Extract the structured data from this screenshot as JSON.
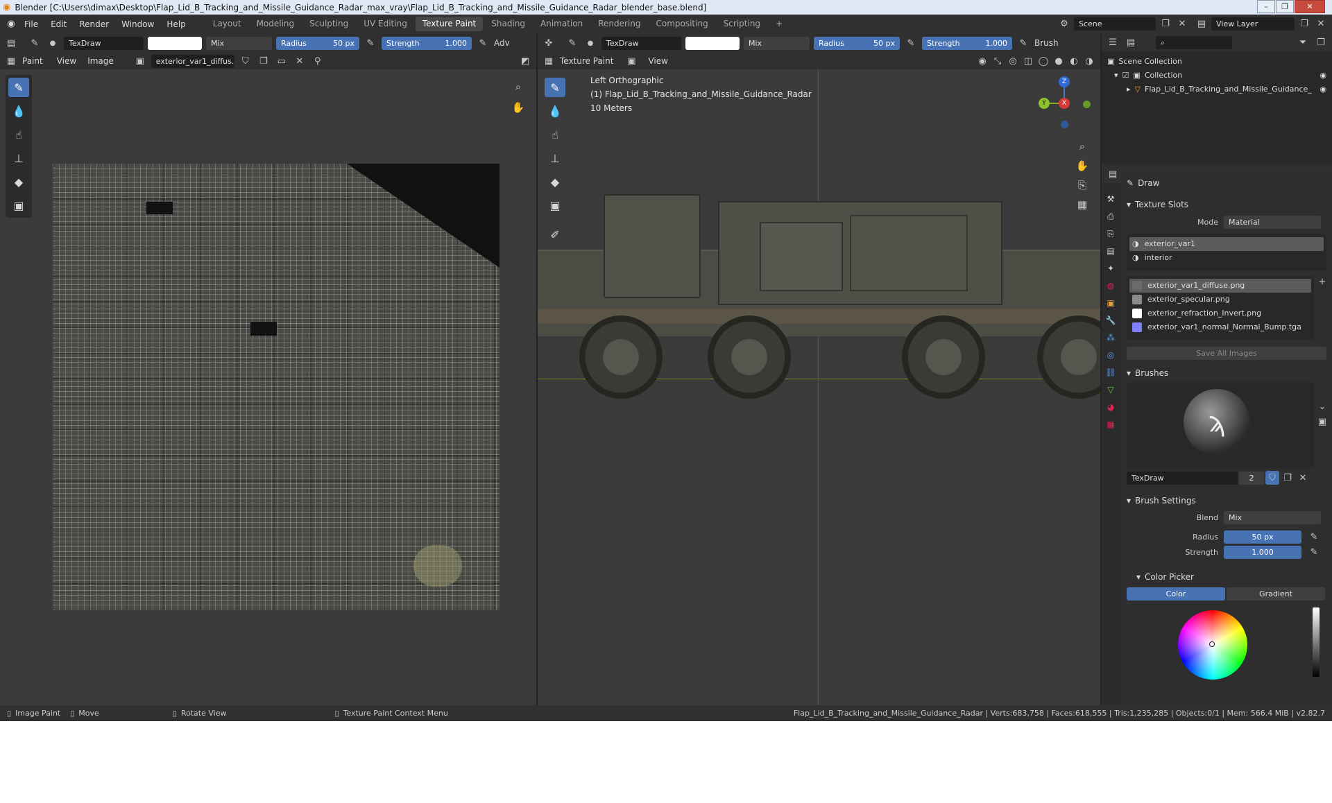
{
  "window": {
    "title": "Blender [C:\\Users\\dimax\\Desktop\\Flap_Lid_B_Tracking_and_Missile_Guidance_Radar_max_vray\\Flap_Lid_B_Tracking_and_Missile_Guidance_Radar_blender_base.blend]",
    "controls": [
      "–",
      "❐",
      "✕"
    ]
  },
  "menus": [
    "File",
    "Edit",
    "Render",
    "Window",
    "Help"
  ],
  "workspaces": [
    "Layout",
    "Modeling",
    "Sculpting",
    "UV Editing",
    "Texture Paint",
    "Shading",
    "Animation",
    "Rendering",
    "Compositing",
    "Scripting",
    "+"
  ],
  "active_workspace": "Texture Paint",
  "scene": {
    "label": "Scene",
    "view_layer": "View Layer"
  },
  "image_editor": {
    "brush": "TexDraw",
    "blend": "Mix",
    "radius_label": "Radius",
    "radius_value": "50 px",
    "strength_label": "Strength",
    "strength_value": "1.000",
    "adv": "Adv",
    "mode": "Paint",
    "menus": [
      "View",
      "Image"
    ],
    "image_name": "exterior_var1_diffus..."
  },
  "viewport": {
    "brush": "TexDraw",
    "blend": "Mix",
    "radius_label": "Radius",
    "radius_value": "50 px",
    "strength_label": "Strength",
    "strength_value": "1.000",
    "brush_menu": "Brush",
    "mode": "Texture Paint",
    "view_menu": "View",
    "view_name": "Left Orthographic",
    "object_name": "(1) Flap_Lid_B_Tracking_and_Missile_Guidance_Radar",
    "scale": "10 Meters",
    "axes": {
      "z": "Z",
      "y": "Y",
      "x": "X"
    }
  },
  "outliner": {
    "search_placeholder": "",
    "scene_collection": "Scene Collection",
    "collection": "Collection",
    "object": "Flap_Lid_B_Tracking_and_Missile_Guidance_"
  },
  "properties": {
    "tool_name": "Draw",
    "texture_slots": {
      "title": "Texture Slots",
      "mode_label": "Mode",
      "mode_value": "Material",
      "materials": [
        "exterior_var1",
        "interior"
      ],
      "images": [
        {
          "name": "exterior_var1_diffuse.png",
          "color": "#6b6b6b"
        },
        {
          "name": "exterior_specular.png",
          "color": "#8a8a8a"
        },
        {
          "name": "exterior_refraction_Invert.png",
          "color": "#ffffff"
        },
        {
          "name": "exterior_var1_normal_Normal_Bump.tga",
          "color": "#8080ff"
        }
      ],
      "save_all": "Save All Images"
    },
    "brushes": {
      "title": "Brushes",
      "name": "TexDraw",
      "users": "2"
    },
    "brush_settings": {
      "title": "Brush Settings",
      "blend_label": "Blend",
      "blend_value": "Mix",
      "radius_label": "Radius",
      "radius_value": "50 px",
      "strength_label": "Strength",
      "strength_value": "1.000"
    },
    "color_picker": {
      "title": "Color Picker",
      "tab_color": "Color",
      "tab_gradient": "Gradient"
    }
  },
  "status_bar": {
    "items": [
      "Image Paint",
      "Move",
      "Rotate View",
      "Texture Paint Context Menu"
    ],
    "stats": "Flap_Lid_B_Tracking_and_Missile_Guidance_Radar | Verts:683,758 | Faces:618,555 | Tris:1,235,285 | Objects:0/1 | Mem: 566.4 MiB | v2.82.7"
  },
  "colors": {
    "accent": "#4772b3",
    "header": "#303030",
    "panel": "#2b2b2b",
    "viewport": "#3b3b3b"
  }
}
